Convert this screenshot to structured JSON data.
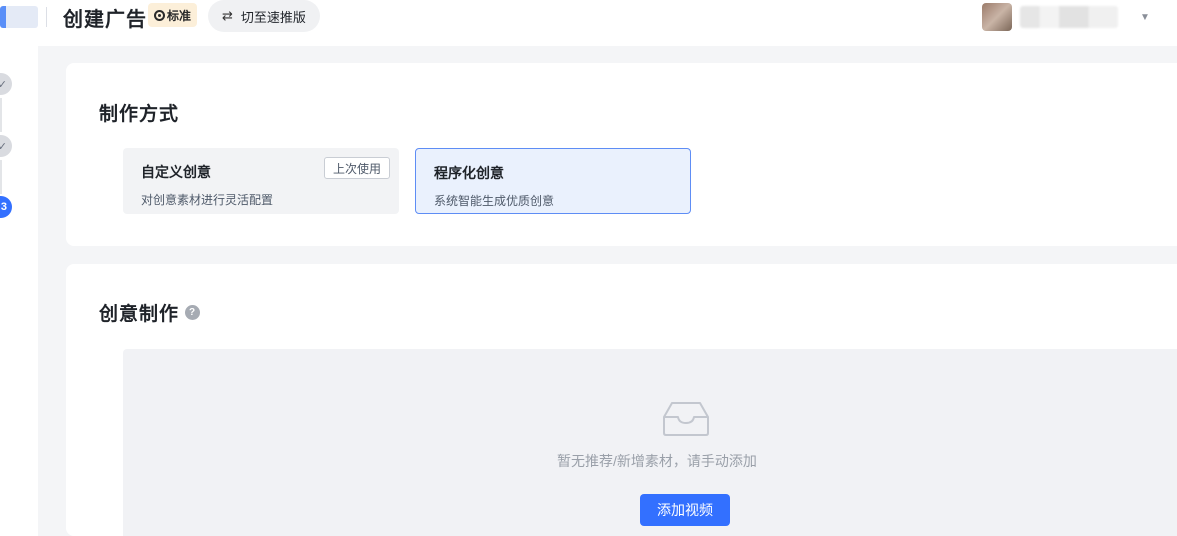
{
  "header": {
    "title": "创建广告",
    "badge_label": "标准",
    "switch_label": "切至速推版",
    "switch_icon": "⇄"
  },
  "stepper": {
    "steps": [
      {
        "label": "✓",
        "state": "done"
      },
      {
        "label": "✓",
        "state": "done"
      },
      {
        "label": "3",
        "state": "active"
      }
    ]
  },
  "method": {
    "title": "制作方式",
    "options": [
      {
        "title": "自定义创意",
        "desc": "对创意素材进行灵活配置",
        "tag": "上次使用",
        "selected": false
      },
      {
        "title": "程序化创意",
        "desc": "系统智能生成优质创意",
        "selected": true
      }
    ]
  },
  "creative": {
    "title": "创意制作",
    "help_icon": "?",
    "empty_text": "暂无推荐/新增素材，请手动添加",
    "add_button": "添加视频"
  },
  "colors": {
    "primary": "#3370ff",
    "selected_bg": "#eaf1fd",
    "badge_bg": "#fcefd9"
  }
}
